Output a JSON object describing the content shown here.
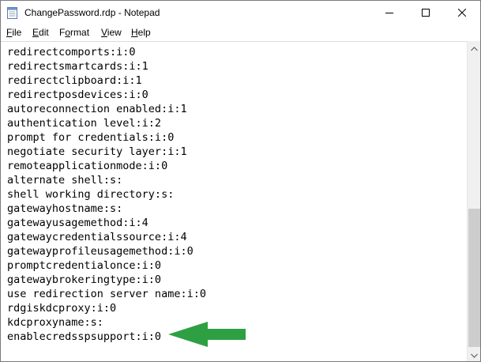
{
  "window": {
    "title": "ChangePassword.rdp - Notepad",
    "app_icon": "notepad-icon",
    "controls": {
      "minimize_icon": "minimize-icon",
      "maximize_icon": "maximize-icon",
      "close_icon": "close-icon"
    }
  },
  "menu": {
    "file": {
      "mnemonic": "F",
      "rest": "ile"
    },
    "edit": {
      "mnemonic": "E",
      "rest": "dit"
    },
    "format": {
      "pre": "F",
      "mnemonic": "o",
      "rest": "rmat"
    },
    "view": {
      "mnemonic": "V",
      "rest": "iew"
    },
    "help": {
      "mnemonic": "H",
      "rest": "elp"
    }
  },
  "editor": {
    "lines": [
      "redirectcomports:i:0",
      "redirectsmartcards:i:1",
      "redirectclipboard:i:1",
      "redirectposdevices:i:0",
      "autoreconnection enabled:i:1",
      "authentication level:i:2",
      "prompt for credentials:i:0",
      "negotiate security layer:i:1",
      "remoteapplicationmode:i:0",
      "alternate shell:s:",
      "shell working directory:s:",
      "gatewayhostname:s:",
      "gatewayusagemethod:i:4",
      "gatewaycredentialssource:i:4",
      "gatewayprofileusagemethod:i:0",
      "promptcredentialonce:i:0",
      "gatewaybrokeringtype:i:0",
      "use redirection server name:i:0",
      "rdgiskdcproxy:i:0",
      "kdcproxyname:s:",
      "enablecredsspsupport:i:0"
    ]
  },
  "scrollbar": {
    "up_icon": "scroll-up-arrow-icon",
    "down_icon": "scroll-down-arrow-icon",
    "position_fraction": 0.58
  },
  "annotation": {
    "icon": "green-arrow-icon",
    "color": "#2ea043",
    "points_to_line": "enablecredsspsupport:i:0"
  }
}
